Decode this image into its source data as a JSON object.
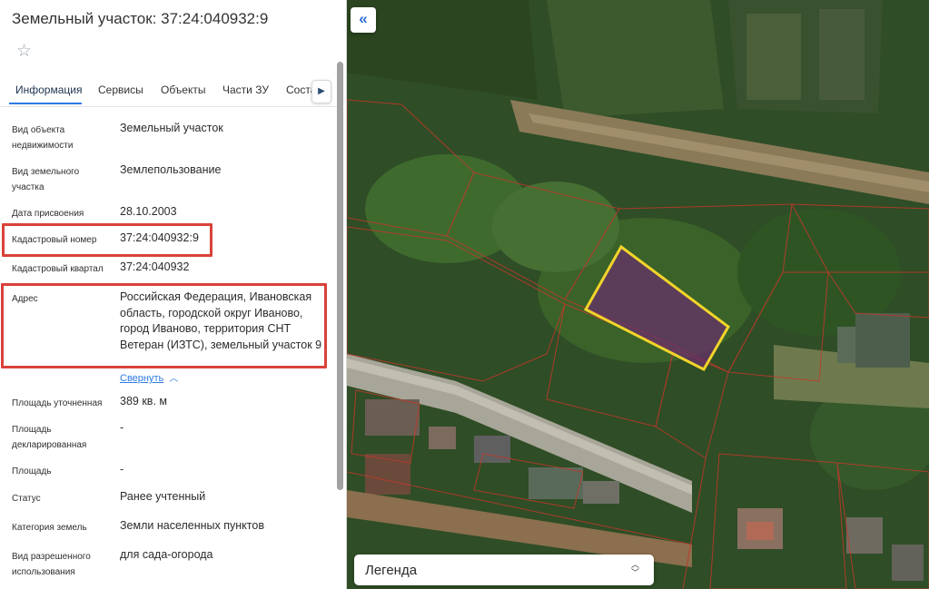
{
  "header": {
    "title": "Земельный участок: 37:24:040932:9",
    "favorite_icon": "star-outline-icon"
  },
  "tabs": [
    "Информация",
    "Сервисы",
    "Объекты",
    "Части ЗУ",
    "Соста"
  ],
  "tabs_next_icon": "chevron-right-icon",
  "info": {
    "object_type_label": "Вид объекта недвижимости",
    "object_type_value": "Земельный участок",
    "land_use_type_label": "Вид земельного участка",
    "land_use_type_value": "Землепользование",
    "assign_date_label": "Дата присвоения",
    "assign_date_value": "28.10.2003",
    "cadastral_number_label": "Кадастровый номер",
    "cadastral_number_value": "37:24:040932:9",
    "cadastral_block_label": "Кадастровый квартал",
    "cadastral_block_value": "37:24:040932",
    "address_label": "Адрес",
    "address_value": "Российская Федерация, Ивановская область, городской округ Иваново, город Иваново, территория СНТ Ветеран (ИЗТС), земельный участок 9",
    "collapse_link": "Свернуть",
    "area_precise_label": "Площадь уточненная",
    "area_precise_value": "389 кв. м",
    "area_declared_label": "Площадь декларированная",
    "area_declared_value": "-",
    "area_label": "Площадь",
    "area_value": "-",
    "status_label": "Статус",
    "status_value": "Ранее учтенный",
    "land_category_label": "Категория земель",
    "land_category_value": "Земли населенных пунктов",
    "permitted_use_label": "Вид разрешенного использования",
    "permitted_use_value": "для сада-огорода"
  },
  "map": {
    "collapse_panel_icon": "double-chevron-left-icon",
    "legend_label": "Легенда",
    "legend_icon": "chevron-up-down-icon"
  },
  "colors": {
    "accent": "#2d7be5",
    "highlight_box": "#d9423a",
    "selected_parcel_stroke": "#f2d42a",
    "selected_parcel_fill": "#6a2e6e",
    "parcel_boundary": "#c0392b"
  }
}
